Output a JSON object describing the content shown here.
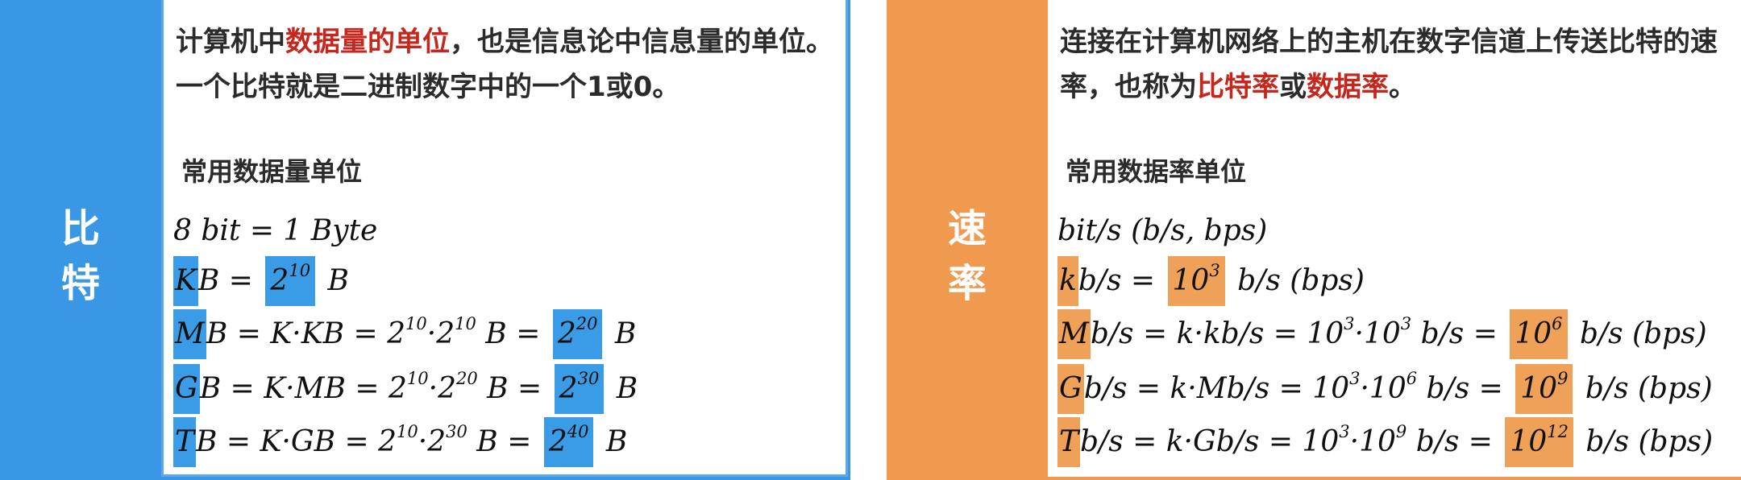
{
  "bit_panel": {
    "side_title_1": "比",
    "side_title_2": "特",
    "intro_a": "计算机中",
    "intro_highlight": "数据量的单位",
    "intro_b": "，也是信息论中信息量的单位。一个比特就是二进制数字中的一个1或0。",
    "subhead": "常用数据量单位",
    "formulas": [
      {
        "plain": "8  bit  =  1  Byte"
      },
      {
        "prefix": "K",
        "mid": "B  =  ",
        "pow_base": "2",
        "pow_exp": "10",
        "tail": "  B"
      },
      {
        "prefix": "M",
        "mid": "B  =  K·KB  =  2",
        "mid_exp1": "10",
        "mid2": "·2",
        "mid_exp2": "10",
        "mid3": "  B  =  ",
        "pow_base": "2",
        "pow_exp": "20",
        "tail": "  B"
      },
      {
        "prefix": "G",
        "mid": "B  =  K·MB  =  2",
        "mid_exp1": "10",
        "mid2": "·2",
        "mid_exp2": "20",
        "mid3": "  B  =  ",
        "pow_base": "2",
        "pow_exp": "30",
        "tail": "  B"
      },
      {
        "prefix": "T",
        "mid": "B  =  K·GB  =  2",
        "mid_exp1": "10",
        "mid2": "·2",
        "mid_exp2": "30",
        "mid3": "  B  =  ",
        "pow_base": "2",
        "pow_exp": "40",
        "tail": "  B"
      }
    ]
  },
  "rate_panel": {
    "side_title_1": "速",
    "side_title_2": "率",
    "intro_a": "连接在计算机网络上的主机在数字信道上传送比特的速率，也称为",
    "intro_highlight1": "比特率",
    "intro_mid": "或",
    "intro_highlight2": "数据率",
    "intro_end": "。",
    "subhead": "常用数据率单位",
    "formulas": [
      {
        "plain": "bit/s  (b/s,  bps)"
      },
      {
        "prefix": "k",
        "mid": "b/s  =  ",
        "pow_base": "10",
        "pow_exp": "3",
        "tail": "  b/s  (bps)"
      },
      {
        "prefix": "M",
        "mid": "b/s  =  k·kb/s  =  10",
        "mid_exp1": "3",
        "mid2": "·10",
        "mid_exp2": "3",
        "mid3": "  b/s  =  ",
        "pow_base": "10",
        "pow_exp": "6",
        "tail": "  b/s  (bps)"
      },
      {
        "prefix": "G",
        "mid": "b/s  =  k·Mb/s  =  10",
        "mid_exp1": "3",
        "mid2": "·10",
        "mid_exp2": "6",
        "mid3": "  b/s  =  ",
        "pow_base": "10",
        "pow_exp": "9",
        "tail": "  b/s  (bps)"
      },
      {
        "prefix": "T",
        "mid": "b/s  =  k·Gb/s  =  10",
        "mid_exp1": "3",
        "mid2": "·10",
        "mid_exp2": "9",
        "mid3": "  b/s  =  ",
        "pow_base": "10",
        "pow_exp": "12",
        "tail": "  b/s  (bps)"
      }
    ]
  },
  "colors": {
    "blue_accent": "#3a97e6",
    "orange_accent": "#ef9a4f",
    "highlight_red": "#c6261c"
  }
}
